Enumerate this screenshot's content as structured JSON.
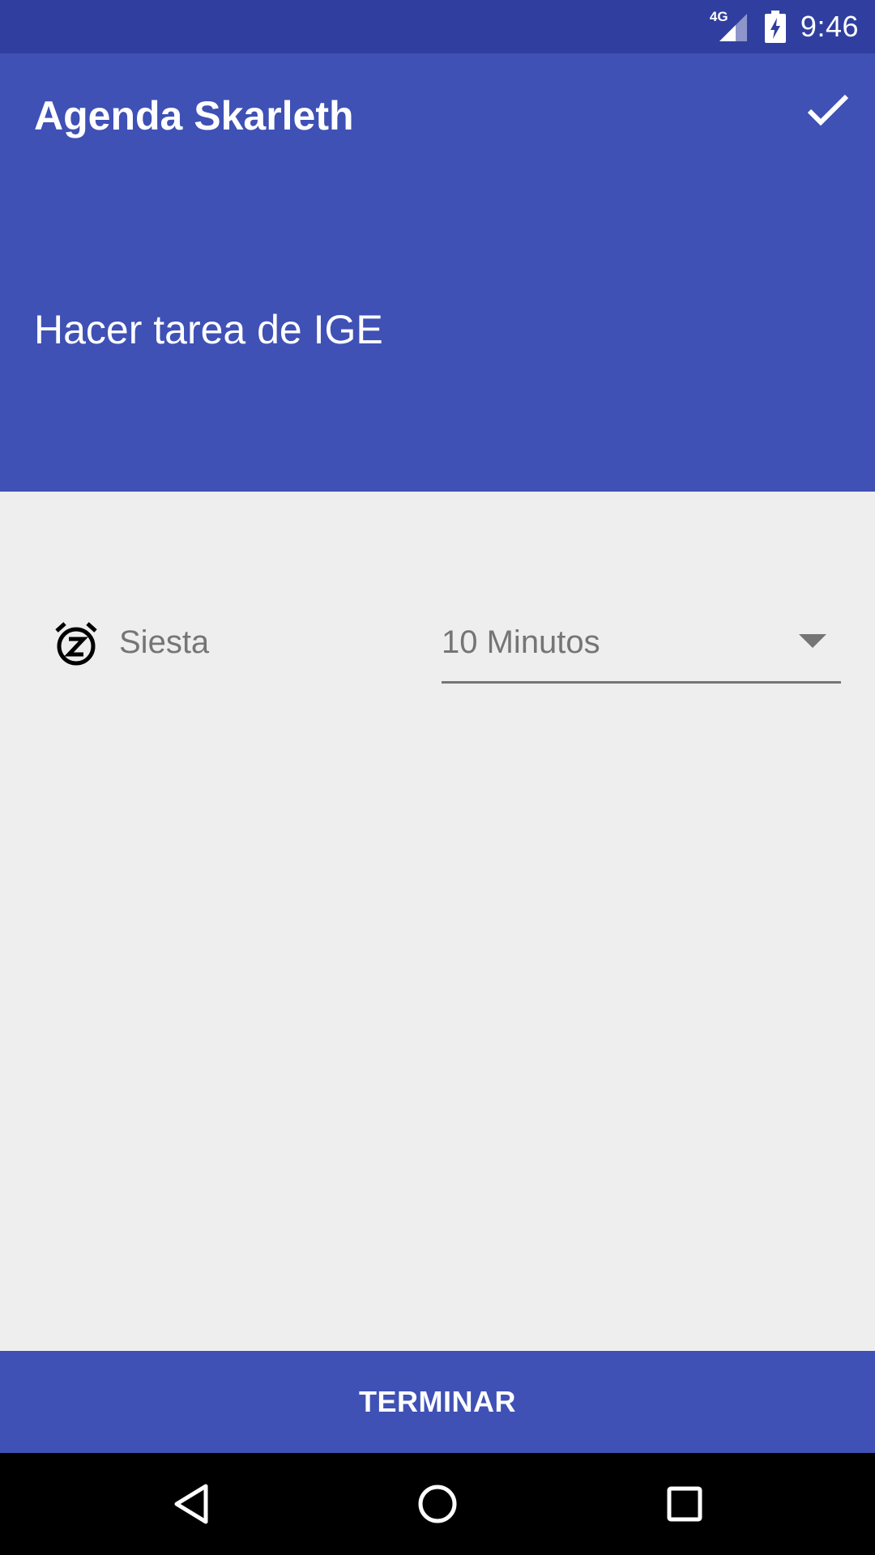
{
  "status_bar": {
    "network": "4G",
    "time": "9:46",
    "icons": [
      "signal-icon",
      "battery-charging-icon"
    ]
  },
  "app_bar": {
    "title": "Agenda Skarleth",
    "action_icon": "check-icon"
  },
  "task": {
    "title": "Hacer tarea de IGE"
  },
  "snooze": {
    "icon": "snooze-icon",
    "label": "Siesta",
    "selected_option": "10 Minutos"
  },
  "footer": {
    "button_label": "TERMINAR"
  },
  "navigation": {
    "icons": [
      "back-icon",
      "home-icon",
      "recents-icon"
    ]
  },
  "colors": {
    "status_bar": "#303f9f",
    "primary": "#3f51b5",
    "background": "#eeeeee",
    "secondary_text": "#757575"
  }
}
